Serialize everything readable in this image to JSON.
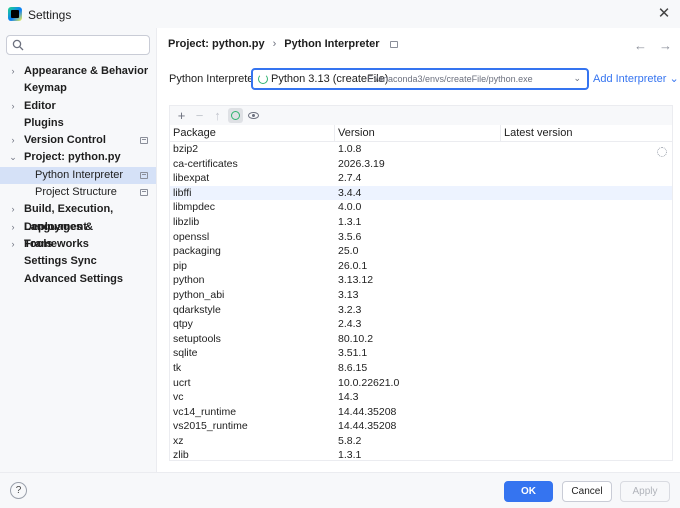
{
  "window": {
    "title": "Settings"
  },
  "sidebar": {
    "search_placeholder": "",
    "items": [
      {
        "label": "Appearance & Behavior",
        "chevron": "›",
        "child": false
      },
      {
        "label": "Keymap",
        "chevron": "",
        "child": false
      },
      {
        "label": "Editor",
        "chevron": "›",
        "child": false
      },
      {
        "label": "Plugins",
        "chevron": "",
        "child": false
      },
      {
        "label": "Version Control",
        "chevron": "›",
        "child": false
      },
      {
        "label": "Project: python.py",
        "chevron": "⌄",
        "child": false
      },
      {
        "label": "Python Interpreter",
        "chevron": "",
        "child": true,
        "selected": true
      },
      {
        "label": "Project Structure",
        "chevron": "",
        "child": true
      },
      {
        "label": "Build, Execution, Deployment",
        "chevron": "›",
        "child": false
      },
      {
        "label": "Languages & Frameworks",
        "chevron": "›",
        "child": false
      },
      {
        "label": "Tools",
        "chevron": "›",
        "child": false
      },
      {
        "label": "Settings Sync",
        "chevron": "",
        "child": false
      },
      {
        "label": "Advanced Settings",
        "chevron": "",
        "child": false
      }
    ]
  },
  "breadcrumb": {
    "project": "Project: python.py",
    "separator": "›",
    "page": "Python Interpreter"
  },
  "interpreter": {
    "label": "Python Interpreter:",
    "selected_name": "Python 3.13 (createFile)",
    "selected_path": "E:/anaconda3/envs/createFile/python.exe",
    "add_label": "Add Interpreter"
  },
  "toolbar": {
    "add": "+",
    "remove": "−",
    "upgrade": "↑"
  },
  "table": {
    "columns": [
      "Package",
      "Version",
      "Latest version"
    ],
    "rows": [
      [
        "bzip2",
        "1.0.8"
      ],
      [
        "ca-certificates",
        "2026.3.19"
      ],
      [
        "libexpat",
        "2.7.4"
      ],
      [
        "libffi",
        "3.4.4"
      ],
      [
        "libmpdec",
        "4.0.0"
      ],
      [
        "libzlib",
        "1.3.1"
      ],
      [
        "openssl",
        "3.5.6"
      ],
      [
        "packaging",
        "25.0"
      ],
      [
        "pip",
        "26.0.1"
      ],
      [
        "python",
        "3.13.12"
      ],
      [
        "python_abi",
        "3.13"
      ],
      [
        "qdarkstyle",
        "3.2.3"
      ],
      [
        "qtpy",
        "2.4.3"
      ],
      [
        "setuptools",
        "80.10.2"
      ],
      [
        "sqlite",
        "3.51.1"
      ],
      [
        "tk",
        "8.6.15"
      ],
      [
        "ucrt",
        "10.0.22621.0"
      ],
      [
        "vc",
        "14.3"
      ],
      [
        "vc14_runtime",
        "14.44.35208"
      ],
      [
        "vs2015_runtime",
        "14.44.35208"
      ],
      [
        "xz",
        "5.8.2"
      ],
      [
        "zlib",
        "1.3.1"
      ]
    ],
    "selected_row": 3
  },
  "footer": {
    "help": "?",
    "ok": "OK",
    "cancel": "Cancel",
    "apply": "Apply"
  },
  "colors": {
    "accent": "#3574f0",
    "selection": "#d5e1f7",
    "row_highlight": "#edf3ff"
  }
}
